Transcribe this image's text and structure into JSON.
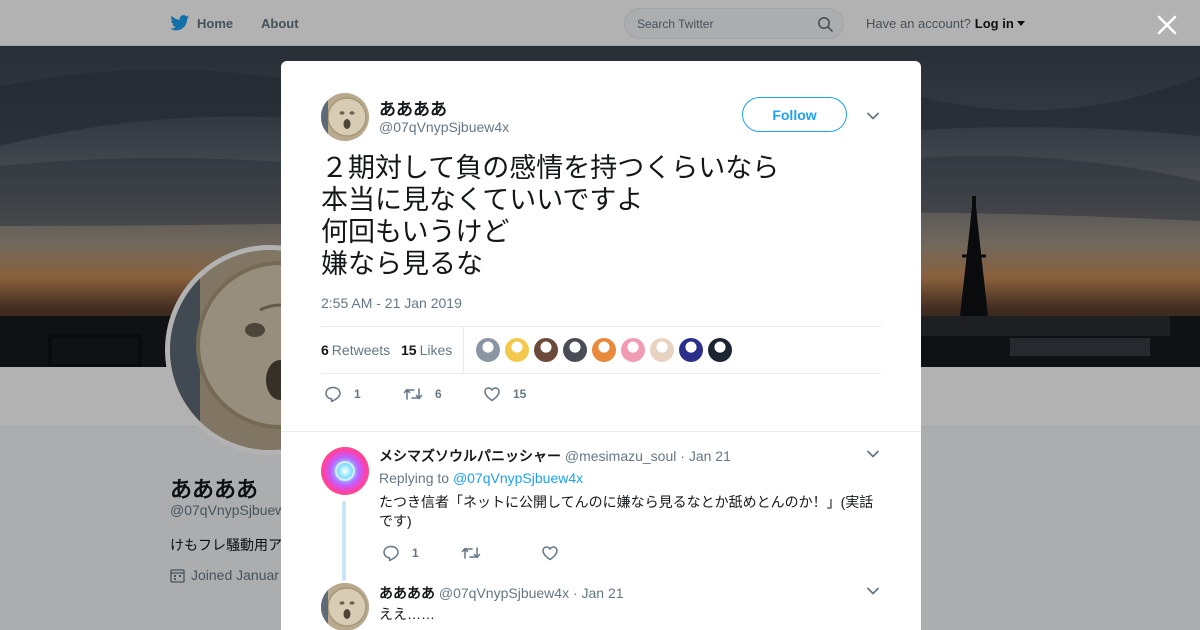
{
  "topbar": {
    "home_label": "Home",
    "about_label": "About",
    "search_placeholder": "Search Twitter",
    "have_account": "Have an account?",
    "login_label": "Log in"
  },
  "profile_bg": {
    "name": "ああああ",
    "handle": "@07qVnypSjbuew4x",
    "bio": "けもフレ騒動用ア",
    "joined": "Joined Januar"
  },
  "tweet": {
    "author_name": "ああああ",
    "author_handle": "@07qVnypSjbuew4x",
    "follow_label": "Follow",
    "lines": [
      "２期対して負の感情を持つくらいなら",
      "本当に見なくていいですよ",
      "何回もいうけど",
      "嫌なら見るな"
    ],
    "timestamp": "2:55 AM - 21 Jan 2019",
    "retweets_count": "6",
    "retweets_label": "Retweets",
    "likes_count": "15",
    "likes_label": "Likes",
    "reply_count": "1",
    "retweet_action_count": "6",
    "like_action_count": "15"
  },
  "liker_colors": [
    "#8a96a3",
    "#f2c94c",
    "#6b4a3a",
    "#4a4d55",
    "#e9893b",
    "#f19bb4",
    "#e8d3c2",
    "#2a2f8c",
    "#1b2430"
  ],
  "replies": [
    {
      "name": "メシマズソウルパニッシャー",
      "handle": "@mesimazu_soul",
      "date": "· Jan 21",
      "replying_prefix": "Replying to",
      "replying_to": "@07qVnypSjbuew4x",
      "text": "たつき信者「ネットに公開してんのに嫌なら見るなとか舐めとんのか！」(実話です)",
      "reply_count": "1"
    },
    {
      "name": "ああああ",
      "handle": "@07qVnypSjbuew4x",
      "date": "· Jan 21",
      "text": "ええ……"
    }
  ],
  "colors": {
    "accent": "#1da1f2",
    "muted": "#657786"
  }
}
